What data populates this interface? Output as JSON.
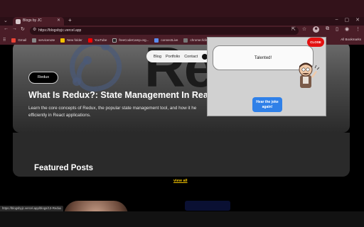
{
  "browser": {
    "tab_title": "Blogs by JC",
    "url": "https://blogsbyjc.vercel.app",
    "bookmarks": [
      {
        "label": "Gmail",
        "color": "#ea4335"
      },
      {
        "label": "servicenote",
        "color": "#888888"
      },
      {
        "label": "New folder",
        "color": "#f2c200"
      },
      {
        "label": "YouTube",
        "color": "#ff0000"
      },
      {
        "label": "freeCodeCamp.org...",
        "color": "#222222"
      },
      {
        "label": "connectLive",
        "color": "#5b8def"
      },
      {
        "label": "chrome://dino/",
        "color": "#777777"
      },
      {
        "label": "jsonplaceholder...",
        "color": "#9b59b6"
      }
    ],
    "all_bookmarks": "All Bookmarks"
  },
  "site": {
    "nav": [
      "Blog",
      "Portfolio",
      "Contact"
    ],
    "watermark": "Re",
    "badge": "Redux",
    "post_title": "What Is Redux?: State Management In React",
    "post_desc": "Learn the core concepts of Redux, the popular state management tool, and how it he efficiently in React applications.",
    "featured_heading": "Featured Posts",
    "view_all": "view all"
  },
  "status_bar": "https://blogsbyjc.vercel.app/blogs/13-Redux",
  "popup": {
    "message": "Talented!",
    "close_label": "CLOSE",
    "joke_button": "Hear the joke again!"
  },
  "colors": {
    "accent_yellow": "#f2c200",
    "close_red": "#e31010",
    "joke_blue": "#2f80e8"
  }
}
